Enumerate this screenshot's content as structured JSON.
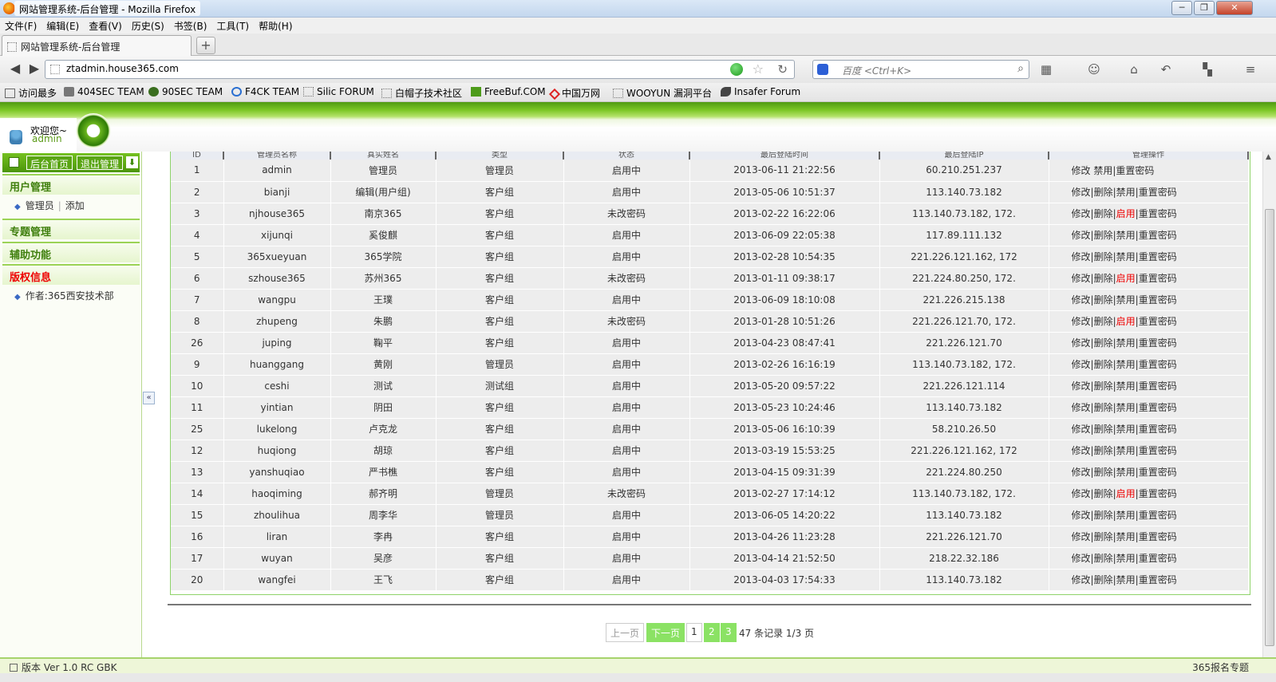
{
  "window": {
    "title": "网站管理系统-后台管理 - Mozilla Firefox",
    "buttons": [
      "─",
      "❐",
      "✕"
    ]
  },
  "menu": [
    "文件(F)",
    "编辑(E)",
    "查看(V)",
    "历史(S)",
    "书签(B)",
    "工具(T)",
    "帮助(H)"
  ],
  "tab": {
    "label": "网站管理系统-后台管理",
    "new_tab": "+"
  },
  "nav": {
    "url": "ztadmin.house365.com",
    "search_placeholder": "百度 <Ctrl+K>"
  },
  "bookmarks": [
    "访问最多",
    "404SEC TEAM",
    "90SEC TEAM",
    "F4CK TEAM",
    "Silic FORUM",
    "白帽子技术社区",
    "FreeBuf.COM",
    "中国万网",
    "WOOYUN 漏洞平台",
    "Insafer Forum"
  ],
  "header": {
    "welcome": "欢迎您~",
    "username": "admin"
  },
  "sidebar": {
    "home_button": "后台首页",
    "logout_button": "退出管理",
    "sections": {
      "user_mgmt": "用户管理",
      "topic_mgmt": "专题管理",
      "aux": "辅助功能",
      "copyright": "版权信息"
    },
    "user_items": {
      "admins": "管理员",
      "add": "添加"
    },
    "author": "作者:365西安技术部"
  },
  "table": {
    "columns": [
      "ID",
      "管理员名称",
      "真实姓名",
      "类型",
      "状态",
      "最后登陆时间",
      "最后登陆IP",
      "管理操作"
    ],
    "rows": [
      [
        "1",
        "admin",
        "管理员",
        "管理员",
        "启用中",
        "2013-06-11 21:22:56",
        "60.210.251.237",
        "admin"
      ],
      [
        "2",
        "bianji",
        "编辑(用户组)",
        "客户组",
        "启用中",
        "2013-05-06 10:51:37",
        "113.140.73.182",
        "normal"
      ],
      [
        "3",
        "njhouse365",
        "南京365",
        "客户组",
        "未改密码",
        "2013-02-22 16:22:06",
        "113.140.73.182, 172.",
        "enable"
      ],
      [
        "4",
        "xijunqi",
        "奚俊麒",
        "客户组",
        "启用中",
        "2013-06-09 22:05:38",
        "117.89.111.132",
        "normal"
      ],
      [
        "5",
        "365xueyuan",
        "365学院",
        "客户组",
        "启用中",
        "2013-02-28 10:54:35",
        "221.226.121.162, 172",
        "normal"
      ],
      [
        "6",
        "szhouse365",
        "苏州365",
        "客户组",
        "未改密码",
        "2013-01-11 09:38:17",
        "221.224.80.250, 172.",
        "enable"
      ],
      [
        "7",
        "wangpu",
        "王璞",
        "客户组",
        "启用中",
        "2013-06-09 18:10:08",
        "221.226.215.138",
        "normal"
      ],
      [
        "8",
        "zhupeng",
        "朱鹏",
        "客户组",
        "未改密码",
        "2013-01-28 10:51:26",
        "221.226.121.70, 172.",
        "enable"
      ],
      [
        "26",
        "juping",
        "鞠平",
        "客户组",
        "启用中",
        "2013-04-23 08:47:41",
        "221.226.121.70",
        "normal"
      ],
      [
        "9",
        "huanggang",
        "黄刚",
        "管理员",
        "启用中",
        "2013-02-26 16:16:19",
        "113.140.73.182, 172.",
        "normal"
      ],
      [
        "10",
        "ceshi",
        "测试",
        "测试组",
        "启用中",
        "2013-05-20 09:57:22",
        "221.226.121.114",
        "normal"
      ],
      [
        "11",
        "yintian",
        "阴田",
        "客户组",
        "启用中",
        "2013-05-23 10:24:46",
        "113.140.73.182",
        "normal"
      ],
      [
        "25",
        "lukelong",
        "卢克龙",
        "客户组",
        "启用中",
        "2013-05-06 16:10:39",
        "58.210.26.50",
        "normal"
      ],
      [
        "12",
        "huqiong",
        "胡琼",
        "客户组",
        "启用中",
        "2013-03-19 15:53:25",
        "221.226.121.162, 172",
        "normal"
      ],
      [
        "13",
        "yanshuqiao",
        "严书樵",
        "客户组",
        "启用中",
        "2013-04-15 09:31:39",
        "221.224.80.250",
        "normal"
      ],
      [
        "14",
        "haoqiming",
        "郝齐明",
        "管理员",
        "未改密码",
        "2013-02-27 17:14:12",
        "113.140.73.182, 172.",
        "enable"
      ],
      [
        "15",
        "zhoulihua",
        "周李华",
        "管理员",
        "启用中",
        "2013-06-05 14:20:22",
        "113.140.73.182",
        "normal"
      ],
      [
        "16",
        "liran",
        "李冉",
        "客户组",
        "启用中",
        "2013-04-26 11:23:28",
        "221.226.121.70",
        "normal"
      ],
      [
        "17",
        "wuyan",
        "吴彦",
        "客户组",
        "启用中",
        "2013-04-14 21:52:50",
        "218.22.32.186",
        "normal"
      ],
      [
        "20",
        "wangfei",
        "王飞",
        "客户组",
        "启用中",
        "2013-04-03 17:54:33",
        "113.140.73.182",
        "normal"
      ]
    ],
    "ops_labels": {
      "edit": "修改",
      "delete": "删除",
      "disable": "禁用",
      "enable": "启用",
      "reset": "重置密码"
    }
  },
  "pagination": {
    "prev": "上一页",
    "next": "下一页",
    "pages": [
      "1",
      "2",
      "3"
    ],
    "info": "47 条记录 1/3 页"
  },
  "status": {
    "version": "版本 Ver 1.0 RC GBK",
    "right_link": "365报名专题"
  },
  "colors": {
    "accent_green": "#7cc726",
    "enable_red": "#e00000",
    "page_green": "#8be264"
  }
}
